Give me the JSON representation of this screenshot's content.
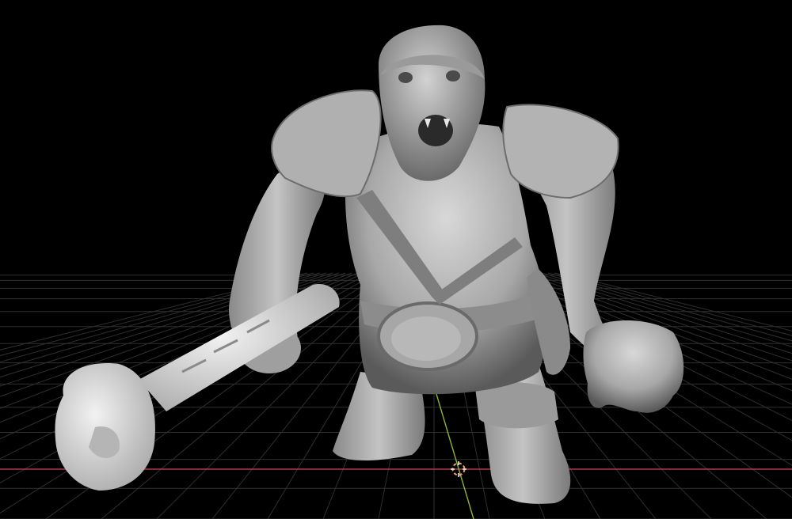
{
  "viewport": {
    "background_color": "#000000",
    "grid_line_color": "#2f2f2f",
    "x_axis_color": "#b0394f",
    "y_axis_color": "#8fb535",
    "sculpt_base_color": "#bdbdbd",
    "sculpt_highlight_color": "#e6e6e6",
    "sculpt_shadow_color": "#5a5a5a",
    "weapon_color": "#dcdcdc",
    "cursor_color": "#f0a060"
  },
  "scene": {
    "object_description": "ogre-sculpt",
    "weapon": "club",
    "cursor_icon": "3d-cursor-icon"
  }
}
